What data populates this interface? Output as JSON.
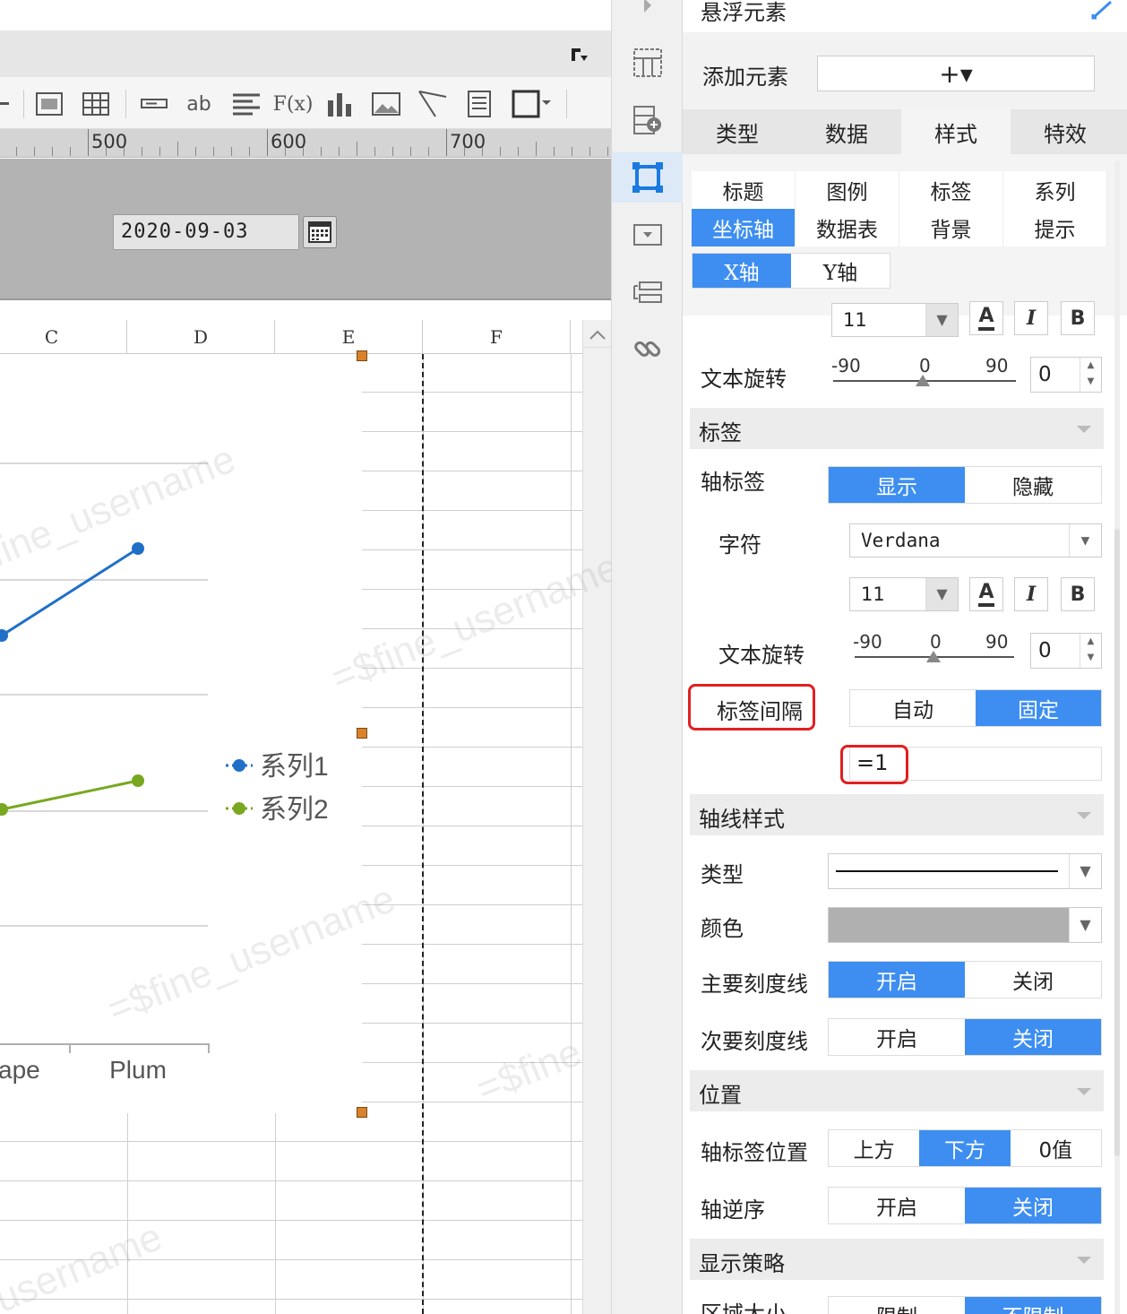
{
  "ruler": {
    "ticks": [
      "500",
      "600",
      "700"
    ]
  },
  "param": {
    "date_value": "2020-09-03"
  },
  "columns": [
    "C",
    "D",
    "E",
    "F"
  ],
  "chart_data": {
    "type": "line",
    "categories": [
      "ape",
      "Plum"
    ],
    "series": [
      {
        "name": "系列1",
        "color": "#1f6fc8"
      },
      {
        "name": "系列2",
        "color": "#78a820"
      }
    ],
    "watermarks": [
      "fine_username",
      "=$fine_username",
      "=$fine_username",
      "=$fine",
      "username"
    ]
  },
  "panel": {
    "header_title": "悬浮元素",
    "add_element_label": "添加元素",
    "add_element_button": "+▾",
    "main_tabs": [
      "类型",
      "数据",
      "样式",
      "特效"
    ],
    "sub_tabs_row1": [
      "标题",
      "图例",
      "标签",
      "系列"
    ],
    "sub_tabs_row2": [
      "坐标轴",
      "数据表",
      "背景",
      "提示"
    ],
    "axis_tabs": [
      "X轴",
      "Y轴"
    ],
    "top_font_size": "11",
    "rotate_label_1": "文本旋转",
    "rotate_min": "-90",
    "rotate_mid": "0",
    "rotate_max": "90",
    "rotate_value_1": "0",
    "section_label": "标签",
    "axis_label_title": "轴标签",
    "axis_label_options": [
      "显示",
      "隐藏"
    ],
    "font_title": "字符",
    "font_value": "Verdana",
    "font_size": "11",
    "rotate_label_2": "文本旋转",
    "rotate_value_2": "0",
    "interval_title": "标签间隔",
    "interval_options": [
      "自动",
      "固定"
    ],
    "interval_value": "=1",
    "section_axis_style": "轴线样式",
    "type_title": "类型",
    "color_title": "颜色",
    "axis_line_color": "#b0b0b0",
    "major_tick_title": "主要刻度线",
    "major_tick_options": [
      "开启",
      "关闭"
    ],
    "minor_tick_title": "次要刻度线",
    "minor_tick_options": [
      "开启",
      "关闭"
    ],
    "section_position": "位置",
    "label_pos_title": "轴标签位置",
    "label_pos_options": [
      "上方",
      "下方",
      "0值"
    ],
    "reverse_title": "轴逆序",
    "reverse_options": [
      "开启",
      "关闭"
    ],
    "section_display": "显示策略",
    "area_size_title": "区域大小",
    "area_size_options": [
      "限制",
      "不限制"
    ],
    "accent_color": "#3d8ef0",
    "highlight_color": "#e02020"
  }
}
